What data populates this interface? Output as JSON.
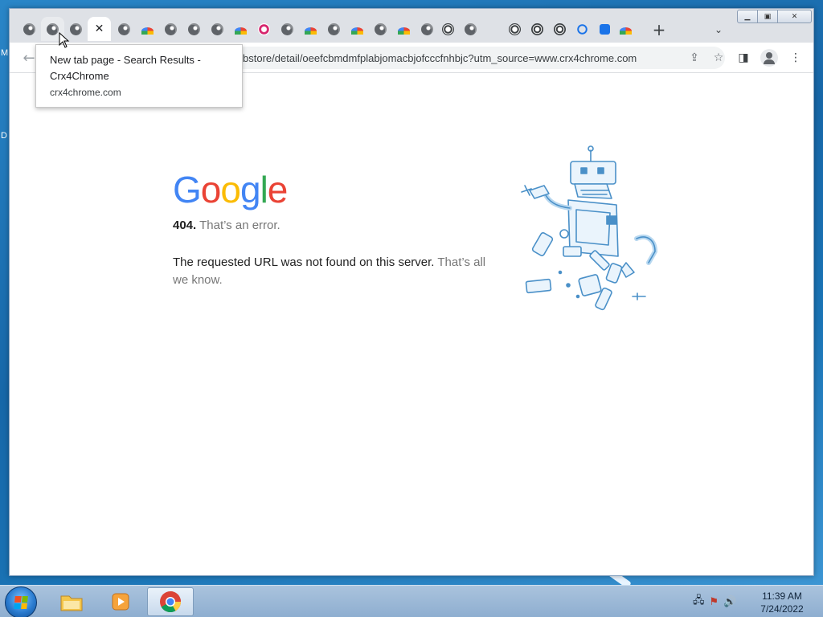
{
  "desktop": {
    "edge_letters": [
      "M",
      "D"
    ]
  },
  "window": {
    "tabs": [
      {
        "favicon": "globe-icon"
      },
      {
        "favicon": "globe-icon"
      },
      {
        "favicon": "globe-icon"
      },
      {
        "favicon": "close-icon",
        "active": true
      },
      {
        "favicon": "globe-icon"
      },
      {
        "favicon": "rainbow-icon"
      },
      {
        "favicon": "globe-icon"
      },
      {
        "favicon": "globe-icon"
      },
      {
        "favicon": "globe-icon"
      },
      {
        "favicon": "rainbow-icon"
      },
      {
        "favicon": "instagram-icon"
      },
      {
        "favicon": "globe-icon"
      },
      {
        "favicon": "rainbow-icon"
      },
      {
        "favicon": "globe-icon"
      },
      {
        "favicon": "rainbow-icon"
      },
      {
        "favicon": "globe-icon"
      },
      {
        "favicon": "rainbow-icon"
      },
      {
        "favicon": "globe-icon"
      },
      {
        "favicon": "dark-globe-icon"
      },
      {
        "favicon": "globe-icon"
      },
      {
        "favicon": "dark-globe-icon"
      },
      {
        "favicon": "chrome-icon"
      },
      {
        "favicon": "chrome-icon"
      },
      {
        "favicon": "history-icon"
      },
      {
        "favicon": "puzzle-icon"
      },
      {
        "favicon": "rainbow-icon"
      }
    ],
    "new_tab_label": "+",
    "tab_search_label": "⌄"
  },
  "toolbar": {
    "url_text": "bstore/detail/oeefcbmdmfplabjomacbjofcccfnhbjc?utm_source=www.crx4chrome.com"
  },
  "tooltip": {
    "title": "New tab page - Search Results - Crx4Chrome",
    "domain": "crx4chrome.com"
  },
  "page": {
    "logo_letters": [
      {
        "char": "G",
        "color": "#4285f4"
      },
      {
        "char": "o",
        "color": "#ea4335"
      },
      {
        "char": "o",
        "color": "#fbbc05"
      },
      {
        "char": "g",
        "color": "#4285f4"
      },
      {
        "char": "l",
        "color": "#34a853"
      },
      {
        "char": "e",
        "color": "#ea4335"
      }
    ],
    "error_code": "404.",
    "error_text": "That’s an error.",
    "description_main": "The requested URL was not found on this server.",
    "description_grey": "That’s all we know."
  },
  "taskbar": {
    "clock_time": "11:39 AM",
    "clock_date": "7/24/2022"
  }
}
